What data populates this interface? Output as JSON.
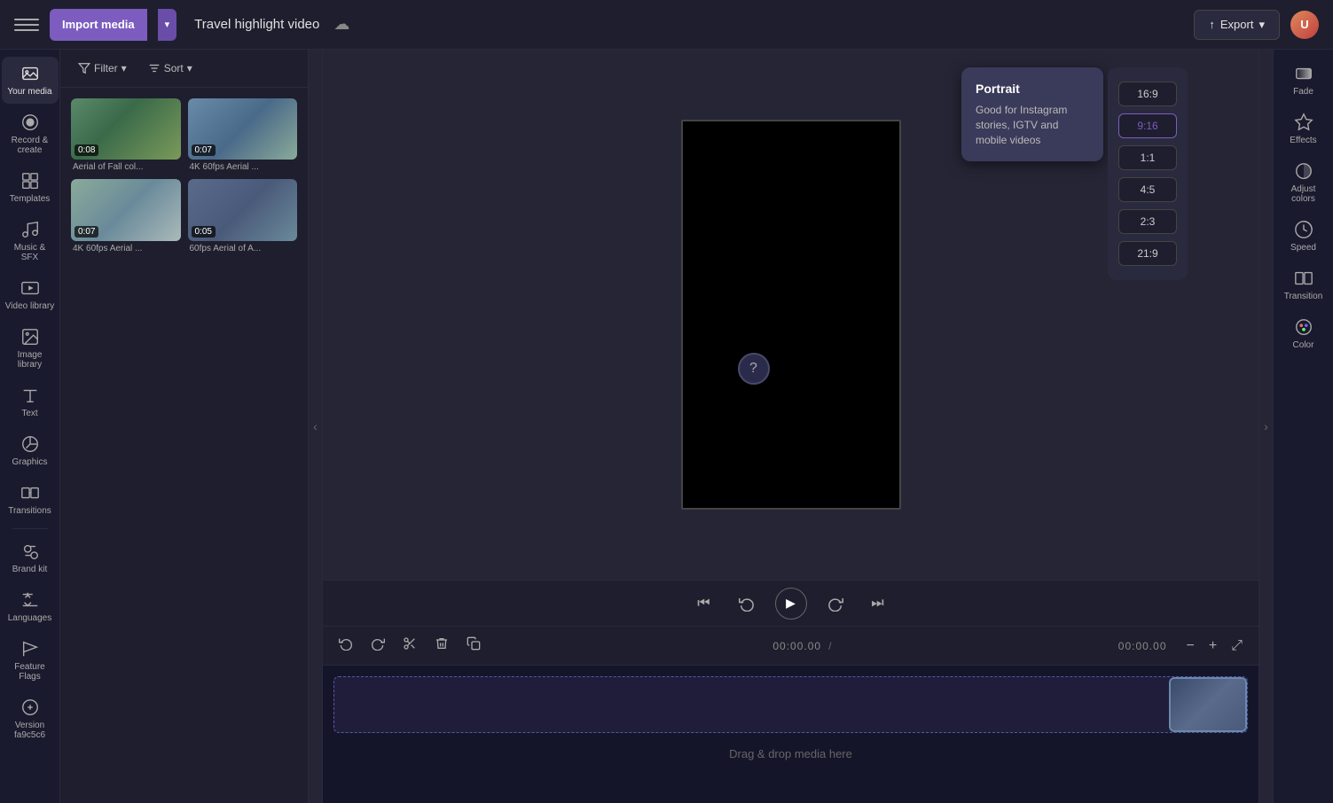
{
  "topbar": {
    "hamburger_label": "Menu",
    "import_label": "Import media",
    "project_title": "Travel highlight video",
    "export_label": "Export",
    "export_icon": "↑",
    "avatar_initials": "U"
  },
  "sidebar": {
    "items": [
      {
        "id": "your-media",
        "label": "Your media",
        "icon": "media"
      },
      {
        "id": "record-create",
        "label": "Record &\ncreate",
        "icon": "record"
      },
      {
        "id": "templates",
        "label": "Templates",
        "icon": "templates"
      },
      {
        "id": "music-sfx",
        "label": "Music & SFX",
        "icon": "music"
      },
      {
        "id": "video-library",
        "label": "Video library",
        "icon": "video"
      },
      {
        "id": "image-library",
        "label": "Image library",
        "icon": "image"
      },
      {
        "id": "text",
        "label": "Text",
        "icon": "text"
      },
      {
        "id": "graphics",
        "label": "Graphics",
        "icon": "graphics"
      },
      {
        "id": "transitions",
        "label": "Transitions",
        "icon": "transitions"
      },
      {
        "id": "brand-kit",
        "label": "Brand kit",
        "icon": "brand"
      },
      {
        "id": "languages",
        "label": "Languages",
        "icon": "languages"
      },
      {
        "id": "feature-flags",
        "label": "Feature Flags",
        "icon": "feature"
      },
      {
        "id": "version",
        "label": "Version\nfa9c5c6",
        "icon": "version"
      }
    ]
  },
  "media_panel": {
    "filter_label": "Filter",
    "sort_label": "Sort",
    "thumbnails": [
      {
        "id": "thumb1",
        "duration": "0:08",
        "label": "Aerial of Fall col..."
      },
      {
        "id": "thumb2",
        "duration": "0:07",
        "label": "4K 60fps Aerial ..."
      },
      {
        "id": "thumb3",
        "duration": "0:07",
        "label": "4K 60fps Aerial ..."
      },
      {
        "id": "thumb4",
        "duration": "0:05",
        "label": "60fps Aerial of A..."
      }
    ]
  },
  "aspect_ratios": {
    "options": [
      {
        "id": "16x9",
        "label": "16:9",
        "selected": false
      },
      {
        "id": "9x16",
        "label": "9:16",
        "selected": true
      },
      {
        "id": "1x1",
        "label": "1:1",
        "selected": false
      },
      {
        "id": "4x5",
        "label": "4:5",
        "selected": false
      },
      {
        "id": "2x3",
        "label": "2:3",
        "selected": false
      },
      {
        "id": "21x9",
        "label": "21:9",
        "selected": false
      }
    ],
    "tooltip": {
      "title": "Portrait",
      "description": "Good for Instagram stories, IGTV and mobile videos"
    }
  },
  "playback": {
    "skip_start_icon": "⏮",
    "rewind_icon": "↺",
    "play_icon": "▶",
    "forward_icon": "↻",
    "skip_end_icon": "⏭"
  },
  "timeline": {
    "time_current": "00:00.00",
    "time_total": "00:00.00",
    "undo_icon": "↩",
    "redo_icon": "↪",
    "cut_icon": "✂",
    "delete_icon": "🗑",
    "copy_icon": "⧉",
    "zoom_out_icon": "−",
    "zoom_in_icon": "+",
    "fit_icon": "⤢",
    "drag_drop_label": "Drag & drop media here"
  },
  "right_panel": {
    "items": [
      {
        "id": "fade",
        "label": "Fade",
        "icon": "fade"
      },
      {
        "id": "effects",
        "label": "Effects",
        "icon": "effects"
      },
      {
        "id": "adjust-colors",
        "label": "Adjust colors",
        "icon": "adjust"
      },
      {
        "id": "speed",
        "label": "Speed",
        "icon": "speed"
      },
      {
        "id": "transition",
        "label": "Transition",
        "icon": "transition"
      },
      {
        "id": "color",
        "label": "Color",
        "icon": "color"
      }
    ]
  }
}
